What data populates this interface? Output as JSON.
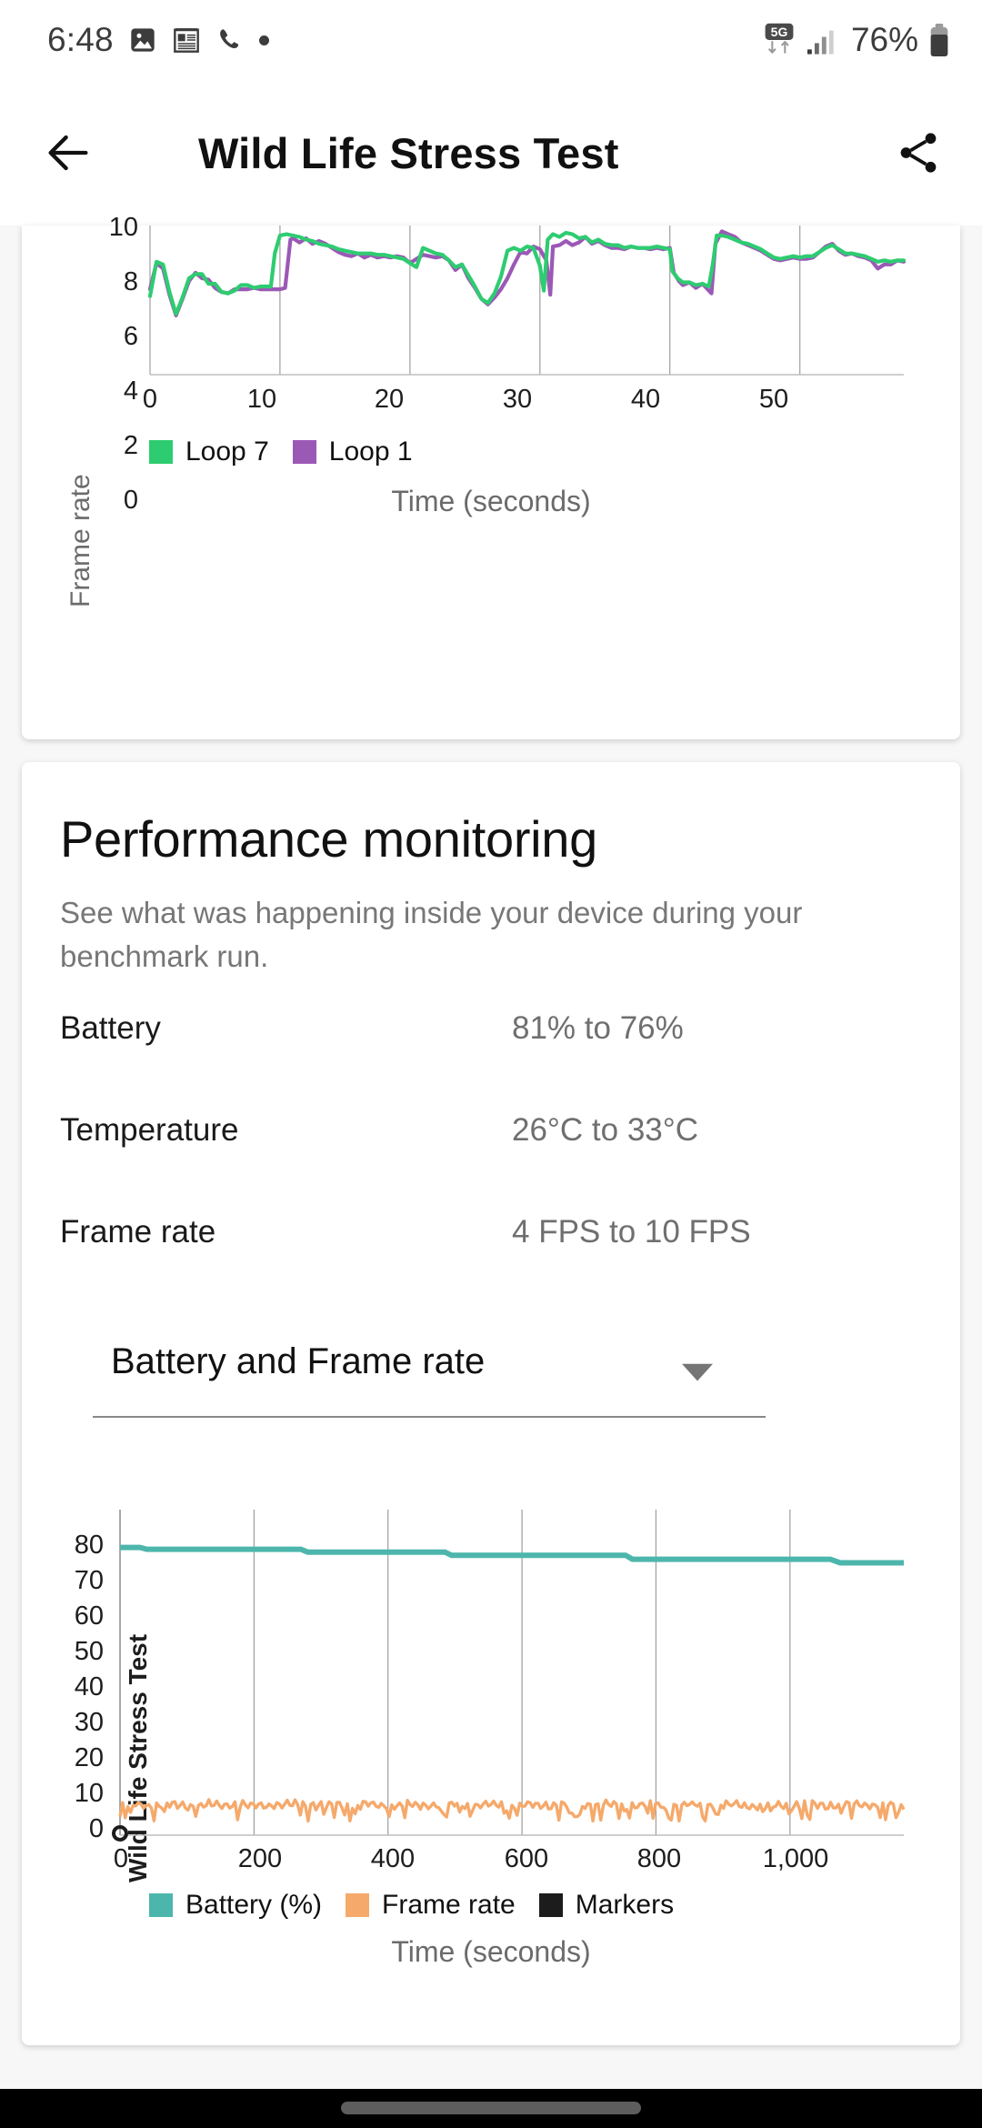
{
  "statusbar": {
    "time": "6:48",
    "icons": [
      "image-icon",
      "calendar-icon",
      "phone-icon",
      "dot-icon"
    ],
    "network": "5G",
    "battery_percent": "76%"
  },
  "appbar": {
    "back_label": "Back",
    "title": "Wild Life Stress Test",
    "share_label": "Share"
  },
  "chart_data": [
    {
      "type": "line",
      "title": "",
      "xlabel": "Time (seconds)",
      "ylabel": "Frame rate",
      "xlim": [
        0,
        58
      ],
      "ylim": [
        0,
        11
      ],
      "xticks": [
        0,
        10,
        20,
        30,
        40,
        50
      ],
      "xtick_labels": [
        "0",
        "10",
        "20",
        "30",
        "40",
        "50"
      ],
      "yticks": [
        0,
        2,
        4,
        6,
        8,
        10
      ],
      "ytick_labels": [
        "0",
        "2",
        "4",
        "6",
        "8",
        "10"
      ],
      "grid": "vertical",
      "legend_position": "bottom-left",
      "series": [
        {
          "name": "Loop 7",
          "color": "#2ECC71",
          "x": [
            0,
            0.5,
            1,
            1.5,
            2,
            2.5,
            3,
            3.5,
            4,
            4.5,
            5,
            5.5,
            6,
            6.5,
            7,
            7.5,
            8,
            8.5,
            9,
            9.3,
            9.6,
            10,
            10.5,
            11,
            11.5,
            12,
            12.5,
            13,
            13.5,
            14,
            14.5,
            15,
            15.5,
            16,
            16.5,
            17,
            17.5,
            18,
            18.5,
            19,
            19.5,
            20,
            20.5,
            21,
            21.5,
            22,
            22.5,
            23,
            23.5,
            24,
            24.5,
            25,
            25.5,
            26,
            26.5,
            27,
            27.5,
            28,
            28.5,
            29,
            29.5,
            30,
            30.3,
            30.6,
            31,
            31.5,
            32,
            32.5,
            33,
            33.5,
            34,
            34.5,
            35,
            35.5,
            36,
            36.5,
            37,
            37.5,
            38,
            38.5,
            39,
            39.5,
            40,
            40.2,
            40.6,
            41,
            41.5,
            42,
            42.5,
            43,
            43.3,
            43.6,
            44,
            44.5,
            45,
            45.5,
            46,
            46.5,
            47,
            47.5,
            48,
            48.5,
            49,
            49.5,
            50,
            50.5,
            51,
            51.5,
            52,
            52.5,
            53,
            53.5,
            54,
            54.5,
            55,
            55.5,
            56,
            56.5,
            57,
            57.5,
            58
          ],
          "y": [
            5.7,
            8.2,
            8.0,
            6.0,
            4.4,
            5.6,
            7.0,
            7.3,
            7.3,
            6.6,
            6.6,
            6.0,
            5.9,
            6.1,
            6.5,
            6.5,
            6.3,
            6.4,
            6.4,
            6.4,
            8.8,
            10.1,
            10.2,
            10.1,
            10.0,
            9.8,
            9.7,
            9.5,
            9.4,
            9.3,
            9.1,
            9.0,
            8.9,
            8.8,
            8.8,
            8.8,
            8.7,
            8.7,
            8.6,
            8.5,
            8.4,
            8.1,
            7.8,
            9.2,
            9.0,
            8.8,
            8.7,
            8.3,
            7.8,
            8.0,
            7.2,
            6.4,
            5.5,
            5.2,
            5.9,
            7.1,
            9.0,
            9.2,
            9.0,
            9.3,
            9.2,
            7.9,
            6.1,
            9.8,
            10.2,
            10.0,
            10.3,
            10.2,
            9.9,
            10.0,
            9.6,
            9.8,
            9.5,
            9.4,
            9.4,
            9.2,
            9.3,
            9.2,
            9.2,
            9.2,
            9.3,
            9.2,
            9.1,
            7.5,
            7.0,
            6.7,
            6.7,
            6.5,
            6.6,
            6.4,
            8.0,
            10.1,
            10.1,
            10.0,
            9.8,
            9.6,
            9.5,
            9.3,
            9.1,
            8.8,
            8.5,
            8.4,
            8.5,
            8.6,
            8.5,
            8.6,
            8.6,
            8.9,
            9.2,
            9.4,
            9.1,
            8.8,
            8.8,
            8.7,
            8.6,
            8.4,
            8.2,
            8.3,
            8.2,
            8.3,
            8.3
          ]
        },
        {
          "name": "Loop 1",
          "color": "#9B59B6",
          "x": [
            0,
            0.5,
            1,
            1.5,
            2,
            2.5,
            3,
            3.5,
            4,
            4.5,
            5,
            5.5,
            6,
            6.5,
            7,
            7.5,
            8,
            8.5,
            9,
            9.5,
            10,
            10.4,
            10.8,
            11,
            11.5,
            12,
            12.5,
            13,
            13.5,
            14,
            14.5,
            15,
            15.5,
            16,
            16.5,
            17,
            17.5,
            18,
            18.5,
            19,
            19.5,
            20,
            20.5,
            21,
            21.5,
            22,
            22.5,
            23,
            23.5,
            24,
            24.5,
            25,
            25.5,
            26,
            26.5,
            27,
            27.5,
            28,
            28.5,
            29,
            29.5,
            30,
            30.5,
            30.8,
            31,
            31.5,
            32,
            32.5,
            33,
            33.5,
            34,
            34.5,
            35,
            35.5,
            36,
            36.5,
            37,
            37.5,
            38,
            38.5,
            39,
            39.5,
            40,
            40.3,
            40.7,
            41,
            41.5,
            42,
            42.5,
            43,
            43.2,
            43.5,
            44,
            44.5,
            45,
            45.5,
            46,
            46.5,
            47,
            47.5,
            48,
            48.5,
            49,
            49.5,
            50,
            50.5,
            51,
            51.5,
            52,
            52.5,
            53,
            53.5,
            54,
            54.5,
            55,
            55.5,
            56,
            56.5,
            57,
            57.5,
            58
          ],
          "y": [
            6.2,
            8.1,
            7.7,
            5.8,
            4.3,
            5.5,
            6.8,
            7.4,
            7.0,
            6.9,
            6.3,
            6.0,
            5.9,
            6.2,
            6.2,
            6.2,
            6.3,
            6.2,
            6.2,
            6.2,
            6.2,
            6.3,
            9.8,
            9.9,
            9.6,
            9.9,
            9.5,
            9.7,
            9.5,
            9.2,
            8.9,
            8.7,
            8.6,
            8.8,
            8.5,
            8.7,
            8.5,
            8.6,
            8.5,
            8.6,
            8.5,
            8.1,
            8.4,
            8.7,
            8.6,
            8.5,
            8.6,
            8.3,
            7.6,
            8.0,
            7.0,
            6.3,
            5.5,
            5.1,
            5.6,
            6.2,
            7.0,
            8.0,
            8.9,
            8.8,
            9.3,
            9.1,
            8.3,
            5.8,
            9.3,
            9.4,
            9.7,
            9.4,
            9.6,
            10.0,
            9.5,
            9.7,
            9.4,
            9.2,
            9.2,
            9.1,
            9.3,
            9.2,
            9.2,
            9.1,
            9.2,
            9.1,
            9.2,
            7.4,
            6.8,
            6.5,
            6.7,
            6.3,
            6.6,
            6.1,
            5.9,
            9.5,
            10.4,
            10.2,
            10.0,
            9.6,
            9.4,
            9.2,
            9.0,
            8.7,
            8.4,
            8.3,
            8.4,
            8.5,
            8.4,
            8.4,
            8.5,
            8.9,
            9.3,
            9.5,
            9.0,
            8.7,
            8.8,
            8.6,
            8.5,
            8.3,
            7.7,
            8.0,
            8.0,
            8.3,
            8.2
          ]
        }
      ]
    },
    {
      "type": "line",
      "title": "",
      "xlabel": "Time (seconds)",
      "ylabel": "Wild Life Stress Test",
      "xlim": [
        0,
        1170
      ],
      "ylim": [
        0,
        85
      ],
      "xticks": [
        0,
        200,
        400,
        600,
        800,
        1000
      ],
      "xtick_labels": [
        "0",
        "200",
        "400",
        "600",
        "800",
        "1,000"
      ],
      "yticks": [
        0,
        10,
        20,
        30,
        40,
        50,
        60,
        70,
        80
      ],
      "ytick_labels": [
        "0",
        "10",
        "20",
        "30",
        "40",
        "50",
        "60",
        "70",
        "80"
      ],
      "grid": "vertical",
      "legend_position": "bottom-left",
      "series": [
        {
          "name": "Battery (%)",
          "color": "#4DB6AC",
          "x": [
            0,
            30,
            40,
            270,
            280,
            485,
            495,
            755,
            765,
            1060,
            1075,
            1170
          ],
          "y": [
            80.5,
            80.5,
            80,
            80,
            79.2,
            79.2,
            78.3,
            78.3,
            77.2,
            77.2,
            76.2,
            76.2
          ]
        },
        {
          "name": "Frame rate",
          "color": "#F5A96B",
          "x": [
            0
          ],
          "y": [
            8
          ],
          "note": "oscillating 4 to 10 around mean 8"
        },
        {
          "name": "Markers",
          "color": "#1c1c1c",
          "x": [],
          "y": []
        }
      ]
    }
  ],
  "performance": {
    "title": "Performance monitoring",
    "subtitle": "See what was happening inside your device during your benchmark run.",
    "stats": [
      {
        "key": "Battery",
        "value": "81% to 76%"
      },
      {
        "key": "Temperature",
        "value": "26°C to 33°C"
      },
      {
        "key": "Frame rate",
        "value": "4 FPS to 10 FPS"
      }
    ],
    "dropdown": {
      "selected": "Battery and Frame rate"
    }
  }
}
